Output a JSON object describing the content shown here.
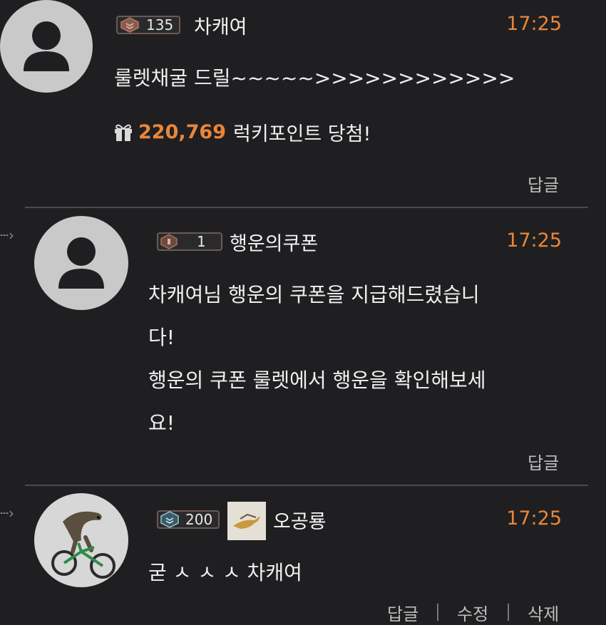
{
  "colors": {
    "accent": "#e9863a",
    "background": "#1f1f21"
  },
  "comments": [
    {
      "author": "차캐여",
      "level": "135",
      "time": "17:25",
      "lines": [
        "룰렛채굴 드릴~~~~~>>>>>>>>>>>>"
      ],
      "reward": {
        "amount": "220,769",
        "text": "럭키포인트 당첨!"
      },
      "actions": [
        "답글"
      ]
    },
    {
      "author": "행운의쿠폰",
      "level": "1",
      "time": "17:25",
      "lines": [
        "차캐여님 행운의 쿠폰을 지급해드렸습니",
        "다!",
        "행운의 쿠폰 룰렛에서 행운을 확인해보세",
        "요!"
      ],
      "actions": [
        "답글"
      ]
    },
    {
      "author": "오공룡",
      "level": "200",
      "time": "17:25",
      "lines": [
        "굳 ㅅ ㅅ ㅅ 차캐여"
      ],
      "actions": [
        "답글",
        "수정",
        "삭제"
      ]
    }
  ]
}
